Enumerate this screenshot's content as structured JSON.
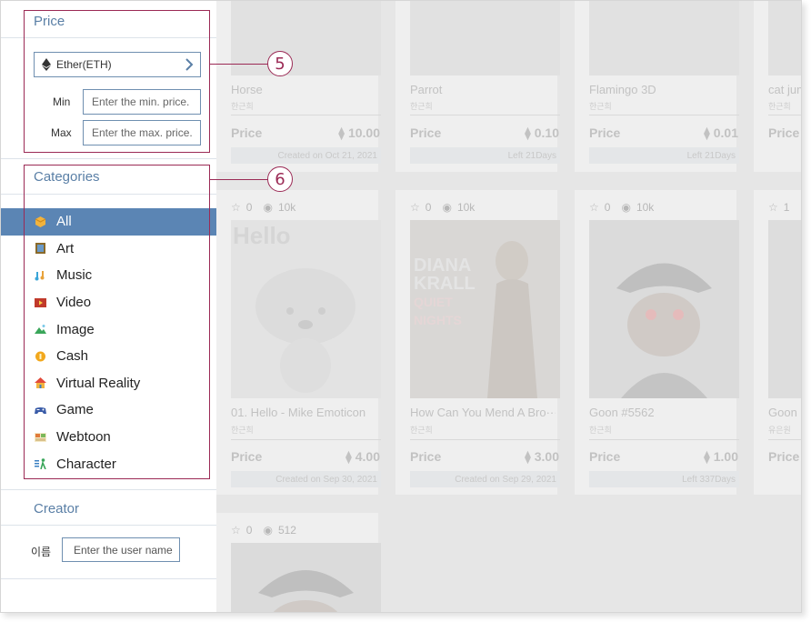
{
  "price": {
    "title": "Price",
    "currency": "Ether(ETH)",
    "min_label": "Min",
    "max_label": "Max",
    "min_placeholder": "Enter the min. price.",
    "max_placeholder": "Enter the max. price."
  },
  "categories": {
    "title": "Categories",
    "items": [
      {
        "label": "All",
        "icon": "box-icon",
        "active": true
      },
      {
        "label": "Art",
        "icon": "picture-frame-icon"
      },
      {
        "label": "Music",
        "icon": "music-note-icon"
      },
      {
        "label": "Video",
        "icon": "video-icon"
      },
      {
        "label": "Image",
        "icon": "landscape-icon"
      },
      {
        "label": "Cash",
        "icon": "coin-icon"
      },
      {
        "label": "Virtual Reality",
        "icon": "house-icon"
      },
      {
        "label": "Game",
        "icon": "gamepad-icon"
      },
      {
        "label": "Webtoon",
        "icon": "comic-icon"
      },
      {
        "label": "Character",
        "icon": "character-icon"
      }
    ]
  },
  "creator": {
    "title": "Creator",
    "name_label": "이름",
    "placeholder": "Enter the user name"
  },
  "callouts": [
    "5",
    "6"
  ],
  "cards": {
    "row1": [
      {
        "name": "Horse",
        "sub": "한근희",
        "price_label": "Price",
        "price": "10.00",
        "footer": "Created on Oct 21, 2021"
      },
      {
        "name": "Parrot",
        "sub": "한근희",
        "price_label": "Price",
        "price": "0.10",
        "footer": "Left 21Days"
      },
      {
        "name": "Flamingo 3D",
        "sub": "한근희",
        "price_label": "Price",
        "price": "0.01",
        "footer": "Left 21Days"
      },
      {
        "name": "cat jum",
        "sub": "한근희",
        "price_label": "Price",
        "price": "",
        "footer": ""
      }
    ],
    "row2": [
      {
        "likes": "0",
        "views": "10k",
        "name": "01. Hello - Mike Emoticon",
        "sub": "한근희",
        "price_label": "Price",
        "price": "4.00",
        "footer": "Created on Sep 30, 2021"
      },
      {
        "likes": "0",
        "views": "10k",
        "name": "How Can You Mend A Bro···",
        "sub": "한근희",
        "price_label": "Price",
        "price": "3.00",
        "footer": "Created on Sep 29, 2021"
      },
      {
        "likes": "0",
        "views": "10k",
        "name": "Goon #5562",
        "sub": "한근희",
        "price_label": "Price",
        "price": "1.00",
        "footer": "Left 337Days"
      },
      {
        "likes": "1",
        "views": "",
        "name": "Goon",
        "sub": "유은원",
        "price_label": "Price",
        "price": "",
        "footer": ""
      }
    ],
    "row3": [
      {
        "likes": "0",
        "views": "512"
      }
    ]
  },
  "thumb_texts": {
    "hello": "Hello",
    "album_line1": "DIANA",
    "album_line2": "KRALL",
    "album_line3": "QUIET",
    "album_line4": "NIGHTS"
  },
  "colors": {
    "accent": "#5b85b4",
    "section_title": "#5a7fa6",
    "highlight": "#9b2a55"
  }
}
